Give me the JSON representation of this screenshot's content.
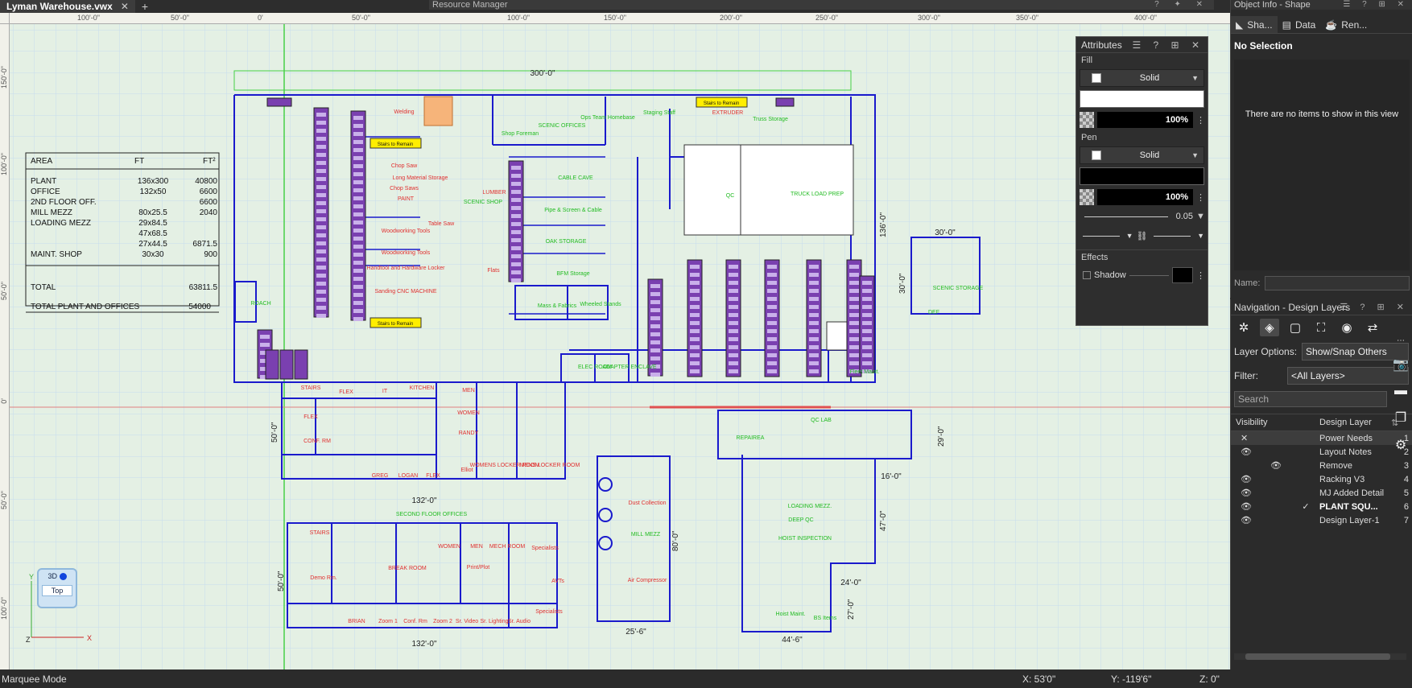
{
  "tabs": {
    "file": "Lyman Warehouse.vwx",
    "close": "✕",
    "add": "+"
  },
  "resource_manager": {
    "title": "Resource Manager",
    "controls": "? ✦ ✕"
  },
  "ruler_top": [
    "100'-0\"",
    "50'-0\"",
    "0'",
    "50'-0\"",
    "100'-0\"",
    "150'-0\"",
    "200'-0\"",
    "250'-0\"",
    "300'-0\"",
    "350'-0\"",
    "400'-0\""
  ],
  "ruler_left": [
    "150'-0\"",
    "100'-0\"",
    "50'-0\"",
    "0'",
    "50'-0\"",
    "100'-0\""
  ],
  "area_table": {
    "headers": [
      "AREA",
      "FT",
      "FT²"
    ],
    "rows": [
      [
        "PLANT",
        "136x300",
        "40800"
      ],
      [
        "OFFICE",
        "132x50",
        "6600"
      ],
      [
        "2ND FLOOR OFF.",
        "",
        "6600"
      ],
      [
        "MILL MEZZ",
        "80x25.5",
        "2040"
      ],
      [
        "LOADING MEZZ",
        "29x84.5",
        ""
      ],
      [
        "",
        "47x68.5",
        ""
      ],
      [
        "",
        "27x44.5",
        "6871.5"
      ],
      [
        "MAINT. SHOP",
        "30x30",
        "900"
      ]
    ],
    "total_label": "TOTAL",
    "total_value": "63811.5",
    "grand_label": "TOTAL PLANT AND OFFICES",
    "grand_value": "54000"
  },
  "dims": {
    "d300": "300'-0\"",
    "d136": "136'-0\"",
    "d132a": "132'-0\"",
    "d132b": "132'-0\"",
    "d50a": "50'-0\"",
    "d50b": "50'-0\"",
    "d30a": "30'-0\"",
    "d30b": "30'-0\"",
    "d80": "80'-0\"",
    "d256": "25'-6\"",
    "d29": "29'-0\"",
    "d16": "16'-0\"",
    "d47": "47'-0\"",
    "d24": "24'-0\"",
    "d27": "27'-0\"",
    "d446": "44'-6\""
  },
  "labels_red": [
    "Welding",
    "Stairs to Remain",
    "Chop Saw",
    "Long Material Storage",
    "Chop Saws",
    "PAINT",
    "LUMBER",
    "Table Saw",
    "Woodworking Tools",
    "Woodworking Tools",
    "Handtool and Hardware Locker",
    "Sanding CNC MACHINE",
    "Stairs to Remain",
    "Flats",
    "EXTRUDER",
    "STAIRS",
    "FLEX",
    "IT",
    "KITCHEN",
    "MEN",
    "WOMEN",
    "RANDY",
    "FLEX",
    "CONF. RM",
    "GREG",
    "LOGAN",
    "FLEX",
    "Elliot",
    "WOMENS LOCKER ROOM",
    "MENS LOCKER ROOM",
    "STAIRS",
    "Demo Rm.",
    "BREAK ROOM",
    "WOMEN",
    "MEN",
    "Print/Plot",
    "MECH ROOM",
    "Specialists",
    "AVTs",
    "Specialists",
    "BRIAN",
    "Zoom 1",
    "Conf. Rm",
    "Zoom 2",
    "Sr. Video",
    "Sr. Lighting",
    "Sr. Audio",
    "Dust Collection",
    "Air Compressor",
    "Stairs to Remain"
  ],
  "labels_green": [
    "SCENIC OFFICES",
    "Ops Team Homebase",
    "Staging Staff",
    "Truss Storage",
    "Shop Foreman",
    "CABLE CAVE",
    "Pipe & Screen & Cable",
    "OAK STORAGE",
    "BFM Storage",
    "SCENIC SHOP",
    "QC",
    "TRUCK LOAD PREP",
    "Mass & Fabrics",
    "Wheeled Stands",
    "ELEC ROOM",
    "ADAPTER ENCLAVE",
    "Fleet Maint.",
    "ROACH",
    "SCENIC STORAGE",
    "DEF",
    "QC LAB",
    "REPAIREA",
    "SECOND FLOOR OFFICES",
    "MILL MEZZ",
    "LOADING MEZZ.",
    "DEEP QC",
    "HOIST INSPECTION",
    "Hoist Maint.",
    "BS Items"
  ],
  "view_cube": {
    "label3d": "3D",
    "top": "Top",
    "axis_y": "Y",
    "axis_x": "X",
    "axis_z": "Z"
  },
  "attributes": {
    "title": "Attributes",
    "icons": "☰ ? ⊞ ✕",
    "fill": "Fill",
    "fill_style": "Solid",
    "fill_opacity": "100%",
    "pen": "Pen",
    "pen_style": "Solid",
    "pen_opacity": "100%",
    "line_weight": "0.05",
    "effects": "Effects",
    "shadow": "Shadow"
  },
  "object_info": {
    "title": "Object Info - Shape",
    "icons": "☰ ? ⊞ ✕",
    "tabs": [
      "Sha...",
      "Data",
      "Ren..."
    ],
    "no_selection": "No Selection",
    "empty": "There are no items to show in this view",
    "name_label": "Name:"
  },
  "navigation": {
    "title": "Navigation - Design Layers",
    "icons": "☰ ? ⊞ ✕",
    "layer_options_label": "Layer Options:",
    "layer_options_value": "Show/Snap Others",
    "filter_label": "Filter:",
    "filter_value": "<All Layers>",
    "search_placeholder": "Search",
    "col_visibility": "Visibility",
    "col_layer": "Design Layer",
    "layers": [
      {
        "name": "Power Needs",
        "num": "1"
      },
      {
        "name": "Layout Notes",
        "num": "2"
      },
      {
        "name": "Remove",
        "num": "3"
      },
      {
        "name": "Racking V3",
        "num": "4"
      },
      {
        "name": "MJ Added Detail",
        "num": "5"
      },
      {
        "name": "PLANT SQU...",
        "num": "6"
      },
      {
        "name": "Design Layer-1",
        "num": "7"
      }
    ]
  },
  "status": {
    "mode": "Marquee Mode",
    "x": "X: 53'0\"",
    "y": "Y: -119'6\"",
    "z": "Z: 0\""
  },
  "colors": {
    "wall": "#1a1acc",
    "rack": "#6a3a9a",
    "red_text": "#e03030",
    "green_text": "#22bb22",
    "canvas": "#e4f0e4",
    "highlight": "#ffee00"
  }
}
